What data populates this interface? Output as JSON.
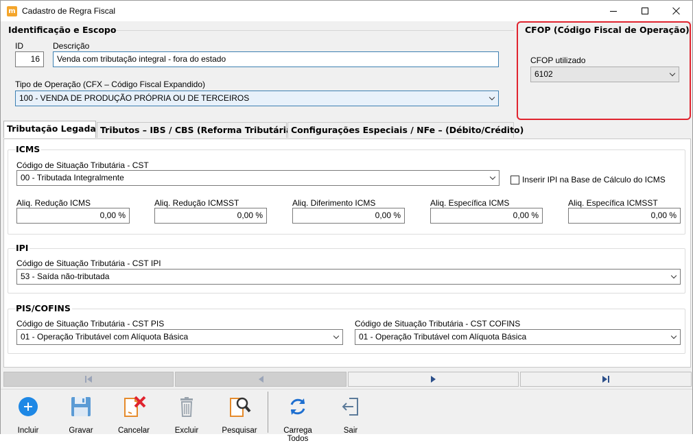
{
  "window": {
    "title": "Cadastro de Regra Fiscal",
    "app_icon_letter": "m"
  },
  "identificacao": {
    "group_title": "Identificação e Escopo",
    "id_label": "ID",
    "id_value": "16",
    "descricao_label": "Descrição",
    "descricao_value": "Venda com tributação integral - fora do estado",
    "tipo_operacao_label": "Tipo de Operação (CFX – Código Fiscal Expandido)",
    "tipo_operacao_value": "100 - VENDA DE PRODUÇÃO PRÓPRIA OU DE TERCEIROS"
  },
  "cfop": {
    "group_title": "CFOP (Código Fiscal de Operação)",
    "label": "CFOP utilizado",
    "value": "6102",
    "highlight_color": "#e0232e"
  },
  "tabs": [
    {
      "label": "Tributação Legada",
      "active": true
    },
    {
      "label": "Tributos – IBS / CBS (Reforma Tributária)",
      "active": false
    },
    {
      "label": "Configurações Especiais / NFe – (Débito/Crédito)",
      "active": false
    }
  ],
  "icms": {
    "group_title": "ICMS",
    "cst_label": "Código de Situação Tributária - CST",
    "cst_value": "00 - Tributada Integralmente",
    "checkbox_label": "Inserir IPI na Base de Cálculo do ICMS",
    "checkbox_checked": false,
    "aliquotas": [
      {
        "label": "Aliq. Redução ICMS",
        "value": "0,00 %"
      },
      {
        "label": "Aliq. Redução ICMSST",
        "value": "0,00 %"
      },
      {
        "label": "Aliq. Diferimento ICMS",
        "value": "0,00 %"
      },
      {
        "label": "Aliq. Específica ICMS",
        "value": "0,00 %"
      },
      {
        "label": "Aliq. Específica ICMSST",
        "value": "0,00 %"
      }
    ]
  },
  "ipi": {
    "group_title": "IPI",
    "cst_label": "Código de Situação Tributária - CST IPI",
    "cst_value": "53 - Saída não-tributada"
  },
  "pis_cofins": {
    "group_title": "PIS/COFINS",
    "pis_label": "Código de Situação Tributária - CST PIS",
    "pis_value": "01 - Operação Tributável com Alíquota Básica",
    "cofins_label": "Código de Situação Tributária - CST COFINS",
    "cofins_value": "01 - Operação Tributável com Alíquota Básica"
  },
  "navigation": [
    {
      "name": "first-record",
      "icon": "skip-first-icon"
    },
    {
      "name": "previous-record",
      "icon": "previous-icon"
    },
    {
      "name": "next-record",
      "icon": "next-icon"
    },
    {
      "name": "last-record",
      "icon": "skip-last-icon"
    }
  ],
  "toolbar": {
    "incluir": "Incluir",
    "gravar": "Gravar",
    "cancelar": "Cancelar",
    "excluir": "Excluir",
    "pesquisar": "Pesquisar",
    "carrega_todos": "Carrega Todos",
    "sair": "Sair",
    "colors": {
      "incluir": "#1e88e5",
      "gravar": "#5b9bd5",
      "cancelar_x": "#e0232e",
      "orange": "#e58a2b",
      "refresh": "#1e6fd0"
    }
  }
}
